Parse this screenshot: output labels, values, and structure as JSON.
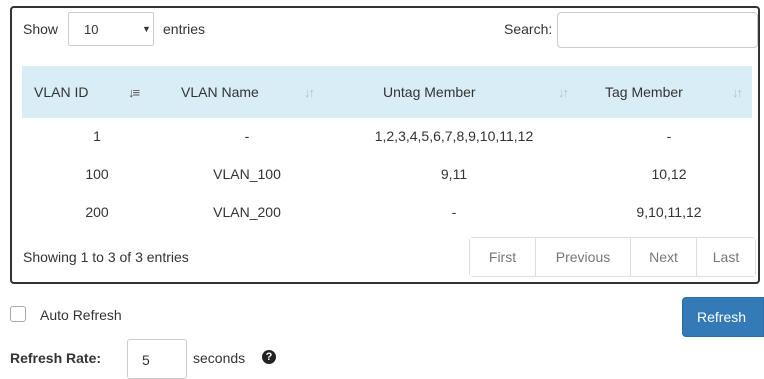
{
  "table_controls": {
    "show_label": "Show",
    "page_length": "10",
    "entries_label": "entries",
    "search_label": "Search:",
    "search_value": ""
  },
  "table": {
    "columns": [
      "VLAN ID",
      "VLAN Name",
      "Untag Member",
      "Tag Member"
    ],
    "rows": [
      [
        "1",
        "-",
        "1,2,3,4,5,6,7,8,9,10,11,12",
        "-"
      ],
      [
        "100",
        "VLAN_100",
        "9,11",
        "10,12"
      ],
      [
        "200",
        "VLAN_200",
        "-",
        "9,10,11,12"
      ]
    ]
  },
  "footer": {
    "info": "Showing 1 to 3 of 3 entries",
    "pagination": [
      "First",
      "Previous",
      "Next",
      "Last"
    ]
  },
  "auto_refresh": {
    "label": "Auto Refresh",
    "checked": false
  },
  "refresh_button": "Refresh",
  "refresh_rate": {
    "label": "Refresh Rate:",
    "value": "5",
    "unit": "seconds"
  },
  "colors": {
    "header_bg": "#d9edf7",
    "primary": "#337ab7",
    "border": "#333333"
  }
}
